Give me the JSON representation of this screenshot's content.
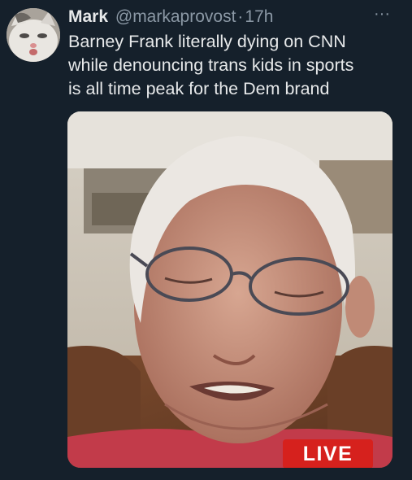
{
  "tweet": {
    "author_name": "Mark",
    "author_handle": "@markaprovost",
    "separator": "·",
    "timestamp": "17h",
    "more_label": "···",
    "text": "Barney Frank literally dying on CNN\nwhile denouncing trans kids in sports\nis all time peak for the Dem brand"
  },
  "media": {
    "live_badge": "LIVE",
    "live_color": "#d6211d"
  },
  "theme": {
    "background": "#15202b",
    "primary_text": "#e7e9ea",
    "secondary_text": "#8b98a5"
  }
}
